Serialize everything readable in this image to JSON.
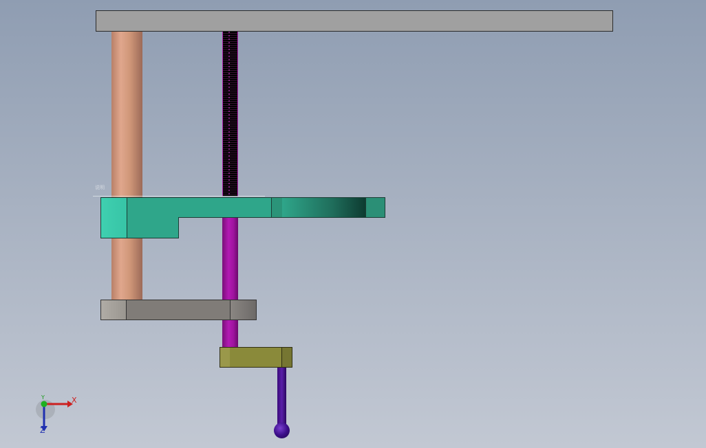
{
  "viewport": {
    "model_tag": "说明",
    "axis_triad": {
      "x_label": "X",
      "y_label": "Y",
      "z_label": "Z",
      "colors": {
        "x": "#cc2020",
        "y": "#1a9a1a",
        "z": "#2030b0"
      }
    }
  },
  "background_colors": {
    "top": "#8f9db2",
    "bottom": "#c2c8d3"
  }
}
